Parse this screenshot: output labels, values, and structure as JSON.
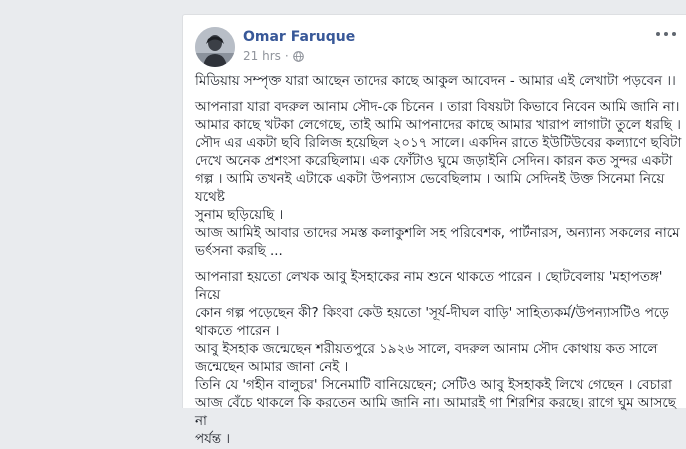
{
  "post": {
    "author": "Omar Faruque",
    "time": "21 hrs",
    "separator": "·",
    "privacy_icon": "globe-icon",
    "more_icon": "more-options-icon",
    "paragraphs": [
      "মিডিয়ায় সম্পৃক্ত যারা আছেন তাদের কাছে আকুল আবেদন - আমার এই লেখাটা পড়বেন ।।",
      "আপনারা যারা বদরুল আনাম সৌদ-কে চিনেন । তারা বিষয়টা কিভাবে নিবেন আমি জানি না।\nআমার কাছে খটকা লেগেছে, তাই আমি আপনাদের কাছে আমার খারাপ লাগাটা তুলে ধরছি ।\nসৌদ এর একটা ছবি রিলিজ হয়েছিল ২০১৭ সালে। একদিন রাতে ইউটিউবের কল্যাণে ছবিটা\nদেখে অনেক প্রশংসা করেছিলাম। এক ফোঁটাও ঘুমে জড়াইনি সেদিন। কারন কত সুন্দর একটা\nগল্প । আমি তখনই এটাকে একটা উপন্যাস ভেবেছিলাম । আমি সেদিনই উক্ত সিনেমা নিয়ে যথেষ্ট\nসুনাম ছড়িয়েছি ।\nআজ আমিই আবার তাদের সমস্ত কলাকুশলি সহ পরিবেশক, পার্টনারস, অন্যান্য সকলের নামে\nভর্ৎসনা করছি ...",
      "আপনারা হয়তো লেখক আবু ইসহাকের নাম শুনে থাকতে পারেন । ছোটবেলায় 'মহাপতঙ্গ' নিয়ে\nকোন গল্প পড়েছেন কী? কিংবা কেউ হয়তো 'সূর্য-দীঘল বাড়ি' সাহিত্যকর্ম/উপন্যাসটিও পড়ে\nথাকতে পারেন ।\nআবু ইসহাক জন্মেছেন শরীয়তপুরে ১৯২৬ সালে, বদরুল আনাম সৌদ কোথায় কত সালে\nজন্মেছেন আমার জানা নেই ।\nতিনি যে 'গহীন বালুচর' সিনেমাটি বানিয়েছেন; সেটিও আবু ইসহাকই লিখে গেছেন । বেচারা\nআজ বেঁচে থাকলে কি করতেন আমি জানি না। আমারই গা শিরশির করছে। রাগে ঘুম আসছে না\nপর্যন্ত ।"
    ]
  }
}
